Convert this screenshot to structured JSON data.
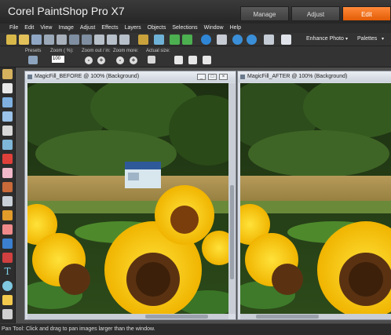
{
  "app": {
    "title": "Corel PaintShop Pro X7"
  },
  "workspace_tabs": [
    {
      "label": "Manage",
      "active": false
    },
    {
      "label": "Adjust",
      "active": false
    },
    {
      "label": "Edit",
      "active": true
    }
  ],
  "menu": [
    "File",
    "Edit",
    "View",
    "Image",
    "Adjust",
    "Effects",
    "Layers",
    "Objects",
    "Selections",
    "Window",
    "Help"
  ],
  "toolbar": {
    "enhance_photo": "Enhance Photo",
    "palettes": "Palettes"
  },
  "tool_options": {
    "presets_label": "Presets",
    "zoom_label": "Zoom ( %):",
    "zoom_value": "100",
    "zoom_out_label": "Zoom out / in:",
    "zoom_more_label": "Zoom more:",
    "actual_size_label": "Actual size:"
  },
  "documents": [
    {
      "title": "MagicFill_BEFORE @ 100% (Background)"
    },
    {
      "title": "MagicFill_AFTER @ 100% (Background)"
    }
  ],
  "status": {
    "text": "Pan Tool: Click and drag to pan images larger than the window."
  },
  "colors": {
    "accent": "#f07320",
    "workspace_bg": "#4e4e4e"
  },
  "icons": [
    "pan-tool-icon",
    "pick-tool-icon",
    "selection-tool-icon",
    "dropper-icon",
    "crop-icon",
    "straighten-icon",
    "red-eye-icon",
    "makeover-icon",
    "clone-brush-icon",
    "scratch-remover-icon",
    "paint-brush-icon",
    "eraser-icon",
    "fill-icon",
    "color-changer-icon",
    "text-icon",
    "shape-icon",
    "pen-icon",
    "warp-icon"
  ]
}
